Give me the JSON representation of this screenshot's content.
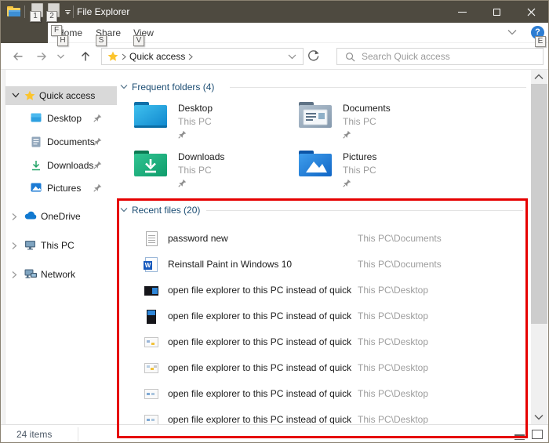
{
  "window": {
    "title": "File Explorer",
    "logo_icon": "file-explorer-logo-icon",
    "controls": [
      "minimize",
      "maximize",
      "close"
    ]
  },
  "keytips": {
    "file": "F",
    "home": "H",
    "share": "S",
    "view": "V",
    "help": "E",
    "qat1": "1",
    "qat2": "2"
  },
  "ribbon": {
    "tabs": [
      {
        "label": "Home"
      },
      {
        "label": "Share"
      },
      {
        "label": "View"
      }
    ],
    "help_glyph": "?",
    "collapse_icon": "chevron-down-icon",
    "help_icon": "help-icon"
  },
  "address_bar": {
    "root_icon": "quick-access-star-icon",
    "breadcrumb_root": "Quick access",
    "refresh_icon": "refresh-icon",
    "search_icon": "search-icon",
    "search_placeholder": "Search Quick access"
  },
  "sidebar": {
    "items": [
      {
        "label": "Quick access",
        "icon": "star-icon",
        "state": "expanded-selected"
      },
      {
        "label": "Desktop",
        "icon": "desktop-icon",
        "pinned": true
      },
      {
        "label": "Documents",
        "icon": "document-icon",
        "pinned": true
      },
      {
        "label": "Downloads",
        "icon": "download-icon",
        "pinned": true
      },
      {
        "label": "Pictures",
        "icon": "picture-icon",
        "pinned": true
      },
      {
        "label": "OneDrive",
        "icon": "onedrive-cloud-icon",
        "state": "collapsed"
      },
      {
        "label": "This PC",
        "icon": "computer-icon",
        "state": "collapsed"
      },
      {
        "label": "Network",
        "icon": "network-icon",
        "state": "collapsed"
      }
    ]
  },
  "content": {
    "frequent": {
      "header": "Frequent folders (4)",
      "tiles": [
        {
          "name": "Desktop",
          "location": "This PC",
          "icon": "desktop-folder-icon"
        },
        {
          "name": "Documents",
          "location": "This PC",
          "icon": "documents-folder-icon"
        },
        {
          "name": "Downloads",
          "location": "This PC",
          "icon": "downloads-folder-icon"
        },
        {
          "name": "Pictures",
          "location": "This PC",
          "icon": "pictures-folder-icon"
        }
      ]
    },
    "recent": {
      "header": "Recent files (20)",
      "word_badge": "W",
      "rows": [
        {
          "name": "password new",
          "path": "This PC\\Documents",
          "icon": "text-file-icon"
        },
        {
          "name": "Reinstall Paint in Windows 10",
          "path": "This PC\\Documents",
          "icon": "word-file-icon"
        },
        {
          "name": "open file explorer to this PC instead of quick ...",
          "path": "This PC\\Desktop",
          "icon": "image-thumbnail-icon"
        },
        {
          "name": "open file explorer to this PC instead of quick ...",
          "path": "This PC\\Desktop",
          "icon": "image-thumbnail-icon"
        },
        {
          "name": "open file explorer to this PC instead of quick ...",
          "path": "This PC\\Desktop",
          "icon": "image-thumbnail-icon"
        },
        {
          "name": "open file explorer to this PC instead of quick ...",
          "path": "This PC\\Desktop",
          "icon": "image-thumbnail-icon"
        },
        {
          "name": "open file explorer to this PC instead of quick ...",
          "path": "This PC\\Desktop",
          "icon": "image-thumbnail-icon"
        },
        {
          "name": "open file explorer to this PC instead of quick ...",
          "path": "This PC\\Desktop",
          "icon": "image-thumbnail-icon"
        }
      ]
    }
  },
  "status_bar": {
    "items_count": "24 items",
    "view_icons": [
      "details-view-icon",
      "thumbnails-view-icon"
    ]
  },
  "annotation": {
    "type": "red-rectangle",
    "color": "#e60000"
  },
  "colors": {
    "titlebar": "#4e4a40",
    "group_header": "#1c4d73",
    "muted_text": "#9d9d9d",
    "selected_item_bg": "#d9d9d9",
    "annotation": "#e60000"
  }
}
